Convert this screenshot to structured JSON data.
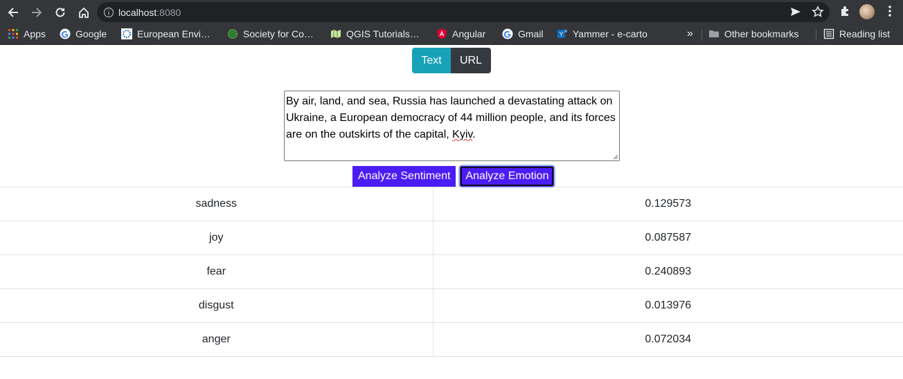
{
  "browser": {
    "url_host": "localhost",
    "url_port": ":8080"
  },
  "bookmarks": {
    "items": [
      {
        "label": "Apps",
        "icon": "apps-grid-icon"
      },
      {
        "label": "Google",
        "icon": "google-icon"
      },
      {
        "label": "European Envi…",
        "icon": "eea-icon"
      },
      {
        "label": "Society for Co…",
        "icon": "globe-icon"
      },
      {
        "label": "QGIS Tutorials…",
        "icon": "qgis-icon"
      },
      {
        "label": "Angular",
        "icon": "angular-icon"
      },
      {
        "label": "Gmail",
        "icon": "google-icon"
      },
      {
        "label": "Yammer - e-carto",
        "icon": "yammer-icon"
      }
    ],
    "overflow": "»",
    "other": "Other bookmarks",
    "reading_list": "Reading list"
  },
  "input_tabs": {
    "text_label": "Text",
    "url_label": "URL"
  },
  "input": {
    "text_before": "By air, land, and sea, Russia has launched a devastating attack on Ukraine, a European democracy of 44 million people, and its forces are on the outskirts of the capital, ",
    "text_misspelled": "Kyiv",
    "text_after": "."
  },
  "actions": {
    "sentiment_label": "Analyze Sentiment",
    "emotion_label": "Analyze Emotion"
  },
  "results": [
    {
      "emotion": "sadness",
      "score": "0.129573"
    },
    {
      "emotion": "joy",
      "score": "0.087587"
    },
    {
      "emotion": "fear",
      "score": "0.240893"
    },
    {
      "emotion": "disgust",
      "score": "0.013976"
    },
    {
      "emotion": "anger",
      "score": "0.072034"
    }
  ],
  "colors": {
    "chrome_bg": "#35363a",
    "text_tab": "#17a2b8",
    "url_tab": "#343a40",
    "action_button": "#4b1df5"
  }
}
